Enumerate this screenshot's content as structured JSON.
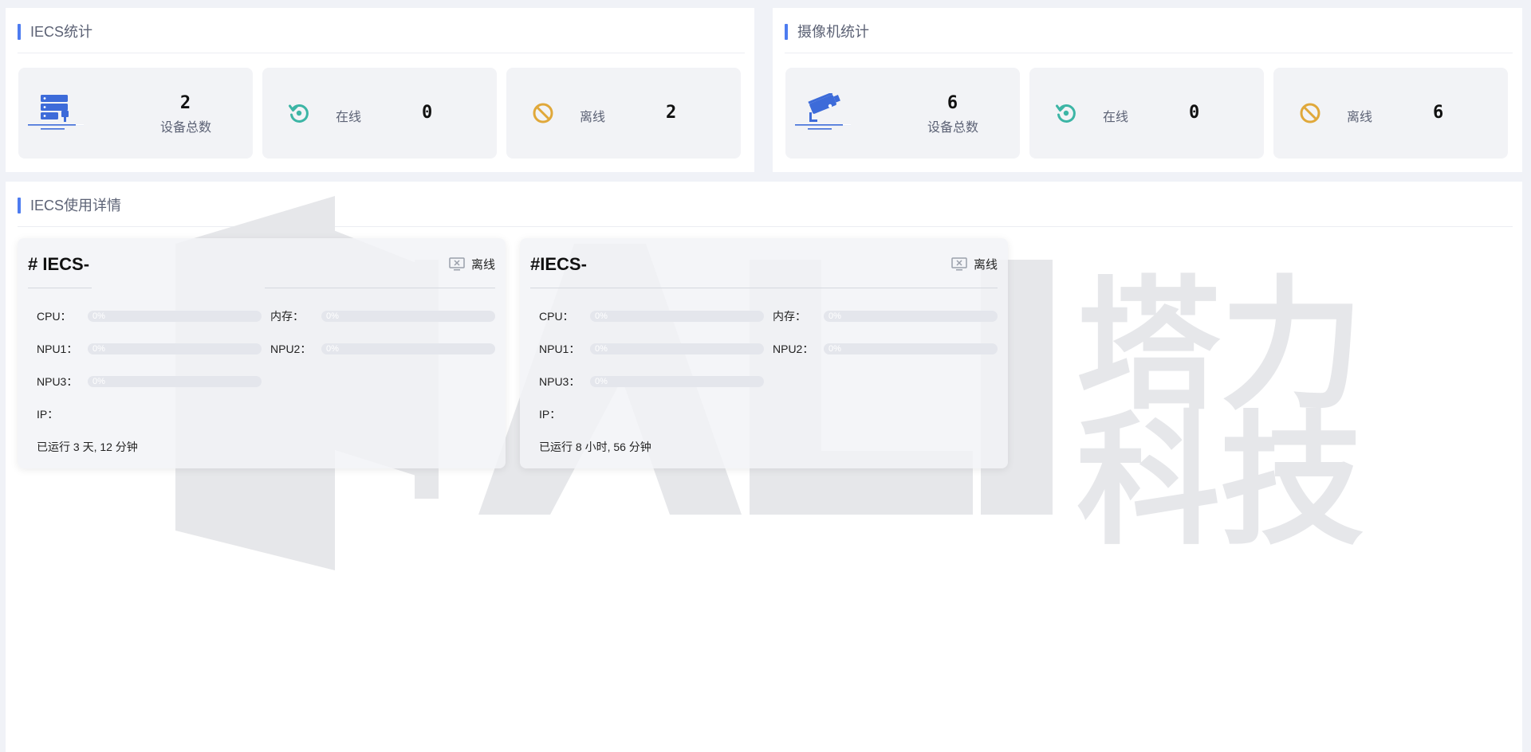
{
  "iecs_stats": {
    "title": "IECS统计",
    "total": {
      "value": "2",
      "label": "设备总数",
      "icon": "server-icon"
    },
    "online": {
      "label": "在线",
      "value": "0",
      "icon": "refresh-icon",
      "color": "#3cb5a5"
    },
    "offline": {
      "label": "离线",
      "value": "2",
      "icon": "ban-icon",
      "color": "#e0a83a"
    }
  },
  "camera_stats": {
    "title": "摄像机统计",
    "total": {
      "value": "6",
      "label": "设备总数",
      "icon": "camera-icon"
    },
    "online": {
      "label": "在线",
      "value": "0",
      "icon": "refresh-icon",
      "color": "#3cb5a5"
    },
    "offline": {
      "label": "离线",
      "value": "6",
      "icon": "ban-icon",
      "color": "#e0a83a"
    }
  },
  "usage": {
    "title": "IECS使用详情",
    "devices": [
      {
        "name": "# IECS-",
        "status": "离线",
        "cpu_label": "CPU：",
        "cpu": "0%",
        "cpu_level": 0,
        "mem_label": "内存：",
        "mem": "0%",
        "mem_level": 0,
        "npu1_label": "NPU1：",
        "npu1": "0%",
        "npu1_level": 0,
        "npu2_label": "NPU2：",
        "npu2": "0%",
        "npu2_level": 0,
        "npu3_label": "NPU3：",
        "npu3": "0%",
        "npu3_level": 0,
        "ip_label": "IP：",
        "uptime": "已运行 3 天, 12 分钟"
      },
      {
        "name": "#IECS-",
        "status": "离线",
        "cpu_label": "CPU：",
        "cpu": "0%",
        "cpu_level": 0,
        "mem_label": "内存：",
        "mem": "0%",
        "mem_level": 0,
        "npu1_label": "NPU1：",
        "npu1": "0%",
        "npu1_level": 0,
        "npu2_label": "NPU2：",
        "npu2": "0%",
        "npu2_level": 0,
        "npu3_label": "NPU3：",
        "npu3": "0%",
        "npu3_level": 0,
        "ip_label": "IP：",
        "uptime": "已运行 8 小时, 56 分钟"
      }
    ]
  },
  "watermark": {
    "text": "塔力科技",
    "color": "#e6e7ea"
  }
}
